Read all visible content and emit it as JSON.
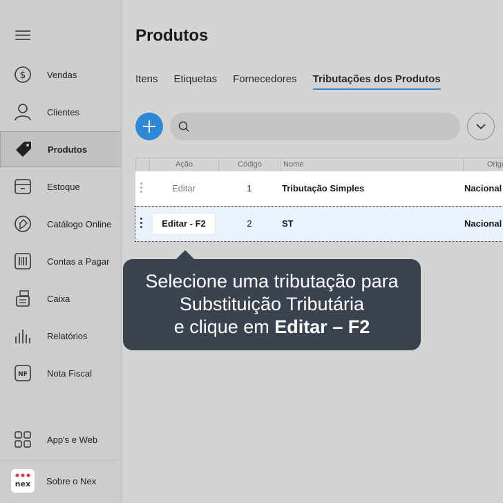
{
  "sidebar": {
    "items": [
      {
        "label": "Vendas",
        "icon": "dollar-circle-icon"
      },
      {
        "label": "Clientes",
        "icon": "person-icon"
      },
      {
        "label": "Produtos",
        "icon": "tag-icon"
      },
      {
        "label": "Estoque",
        "icon": "box-icon"
      },
      {
        "label": "Catálogo Online",
        "icon": "catalog-icon"
      },
      {
        "label": "Contas a Pagar",
        "icon": "barcode-icon"
      },
      {
        "label": "Caixa",
        "icon": "register-icon"
      },
      {
        "label": "Relatórios",
        "icon": "bars-icon"
      },
      {
        "label": "Nota Fiscal",
        "icon": "nf-icon"
      }
    ],
    "nf_icon_text": "NF",
    "apps_label": "App's e Web",
    "about_label": "Sobre o Nex",
    "logo_text": "nex"
  },
  "main": {
    "title": "Produtos",
    "tabs": [
      "Itens",
      "Etiquetas",
      "Fornecedores",
      "Tributações dos Produtos"
    ],
    "search_placeholder": ""
  },
  "table": {
    "columns": [
      "Ação",
      "Código",
      "Nome",
      "Origem"
    ],
    "rows": [
      {
        "action": "Editar",
        "code": "1",
        "name": "Tributação Simples",
        "origin": "Nacional"
      },
      {
        "action": "Editar - F2",
        "code": "2",
        "name": "ST",
        "origin": "Nacional"
      }
    ]
  },
  "tooltip": {
    "line1": "Selecione uma tributação para",
    "line2": "Substituição Tributária",
    "line3_prefix": "e clique em ",
    "line3_bold": "Editar – F2"
  },
  "colors": {
    "accent": "#2f87d8",
    "tooltip_bg": "#3b4350",
    "logo_red": "#d9363e"
  }
}
